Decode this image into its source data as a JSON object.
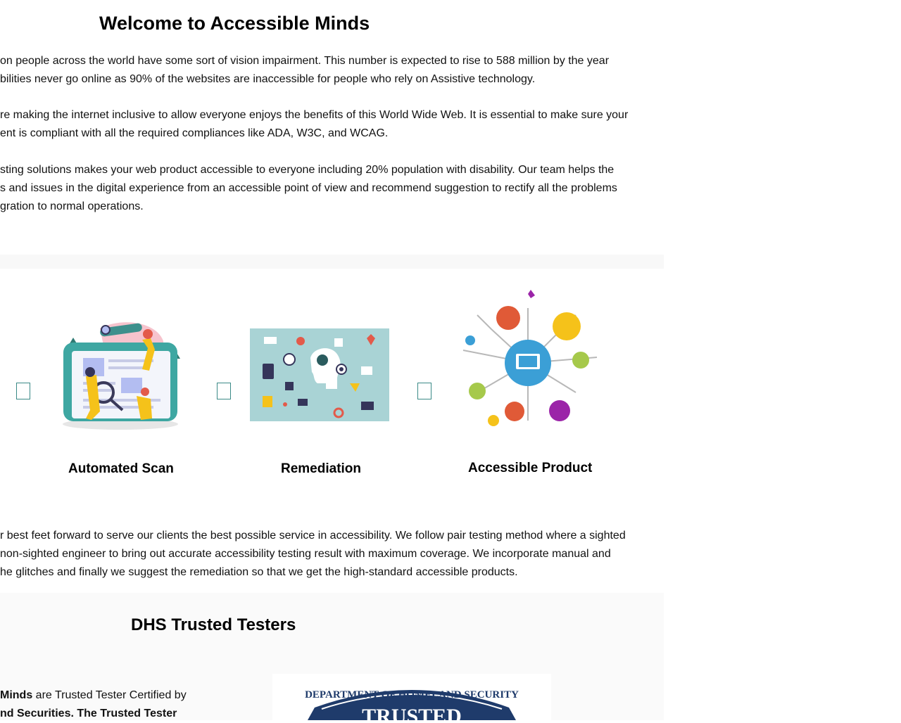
{
  "page": {
    "title": "Welcome to Accessible Minds"
  },
  "intro": {
    "p1_line1": "on people across the world have some sort of vision impairment. This number is expected to rise to 588 million by the year",
    "p1_line2": "bilities never go online as 90% of the websites are inaccessible for people who rely on Assistive technology.",
    "p2_line1": "re making the internet inclusive to allow everyone enjoys the benefits of this World Wide Web. It is essential to make sure your",
    "p2_line2": "ent is compliant with all the required compliances like ADA, W3C, and WCAG.",
    "p3_line1": "sting solutions makes your web product accessible to everyone including 20% population with disability. Our team helps the",
    "p3_line2": "s and issues in the digital experience from an accessible point of view and recommend suggestion to rectify all the problems",
    "p3_line3": "gration to normal operations."
  },
  "services": [
    {
      "label": "Automated Scan",
      "icon": "magnifier-team-illustration"
    },
    {
      "label": "Remediation",
      "icon": "head-ideas-illustration"
    },
    {
      "label": "Accessible Product",
      "icon": "laptop-network-illustration"
    }
  ],
  "approach": {
    "line1": "r best feet forward to serve our clients the best possible service in accessibility. We follow pair testing method where a sighted",
    "line2": "non-sighted engineer to bring out accurate accessibility testing result with maximum coverage. We incorporate manual and",
    "line3": "he glitches and finally we suggest the remediation so that we get the high-standard accessible products."
  },
  "dhs": {
    "heading": "DHS Trusted Testers",
    "line1_bold": "Minds",
    "line1_rest": " are Trusted Tester Certified by",
    "line2_bold": "nd Securities. The Trusted Tester",
    "badge_top": "DEPARTMENT OF HOMELAND SECURITY",
    "badge_main": "TRUSTED"
  },
  "colors": {
    "teal": "#3a8a87",
    "badge_navy": "#1f3b6b"
  }
}
